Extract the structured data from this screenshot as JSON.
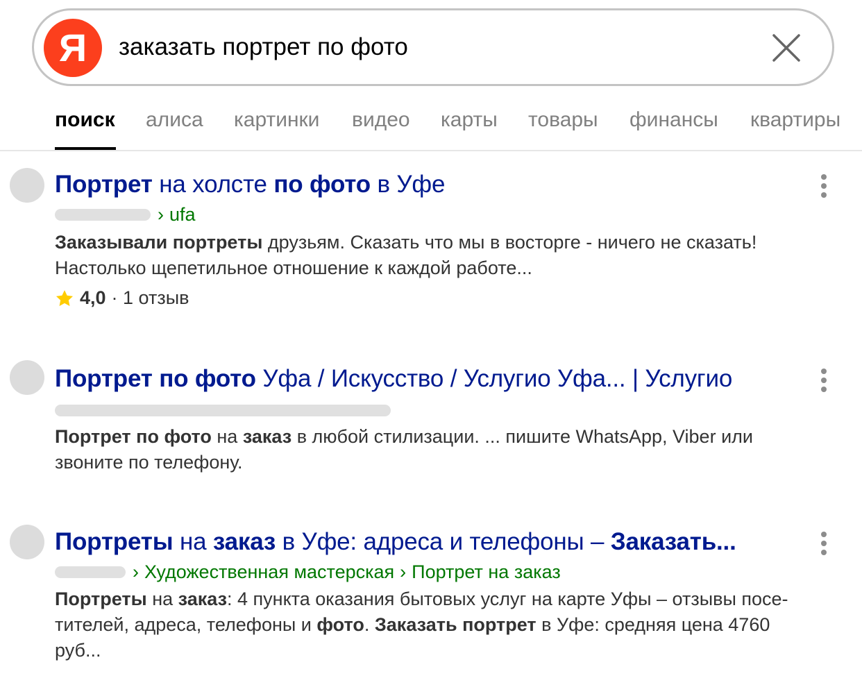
{
  "search": {
    "logo_letter": "Я",
    "query": "заказать портрет по фото",
    "logo_color": "#fc3f1d"
  },
  "tabs": [
    {
      "label": "поиск",
      "active": true
    },
    {
      "label": "алиса"
    },
    {
      "label": "картинки"
    },
    {
      "label": "видео"
    },
    {
      "label": "карты"
    },
    {
      "label": "товары"
    },
    {
      "label": "финансы"
    },
    {
      "label": "квартиры"
    }
  ],
  "results": [
    {
      "title": [
        {
          "t": "Портрет",
          "b": true
        },
        {
          "t": " на холсте "
        },
        {
          "t": "по фото",
          "b": true
        },
        {
          "t": " в Уфе"
        }
      ],
      "path": [
        "ufa"
      ],
      "snippet": [
        {
          "t": "Заказывали портреты",
          "b": true
        },
        {
          "t": " друзьям. Сказать что мы в восторге - ничего не сказать!\nНастолько щепетильное отношение к каждой работе..."
        }
      ],
      "rating": {
        "score": "4,0",
        "reviews": "· 1 отзыв"
      }
    },
    {
      "title": [
        {
          "t": "Портрет по фото",
          "b": true
        },
        {
          "t": " Уфа / Искусство / Услугио Уфа... | Услугио"
        }
      ],
      "path": [],
      "snippet": [
        {
          "t": "Портрет по фото",
          "b": true
        },
        {
          "t": " на "
        },
        {
          "t": "заказ",
          "b": true
        },
        {
          "t": " в любой стилизации. ... пишите WhatsApp, Viber или\nзвоните по телефону."
        }
      ]
    },
    {
      "title": [
        {
          "t": "Портреты",
          "b": true
        },
        {
          "t": " на "
        },
        {
          "t": "заказ",
          "b": true
        },
        {
          "t": " в Уфе: адреса и телефоны – "
        },
        {
          "t": "Заказать...",
          "b": true
        }
      ],
      "path": [
        "Художественная мастерская",
        "Портрет на заказ"
      ],
      "snippet": [
        {
          "t": "Портреты",
          "b": true
        },
        {
          "t": " на "
        },
        {
          "t": "заказ",
          "b": true
        },
        {
          "t": ": 4 пункта оказания бытовых услуг на карте Уфы – отзывы посе-\nтителей, адреса, телефоны и "
        },
        {
          "t": "фото",
          "b": true
        },
        {
          "t": ". "
        },
        {
          "t": "Заказать портрет",
          "b": true
        },
        {
          "t": " в Уфе: средняя цена 4760\nруб..."
        }
      ]
    }
  ]
}
